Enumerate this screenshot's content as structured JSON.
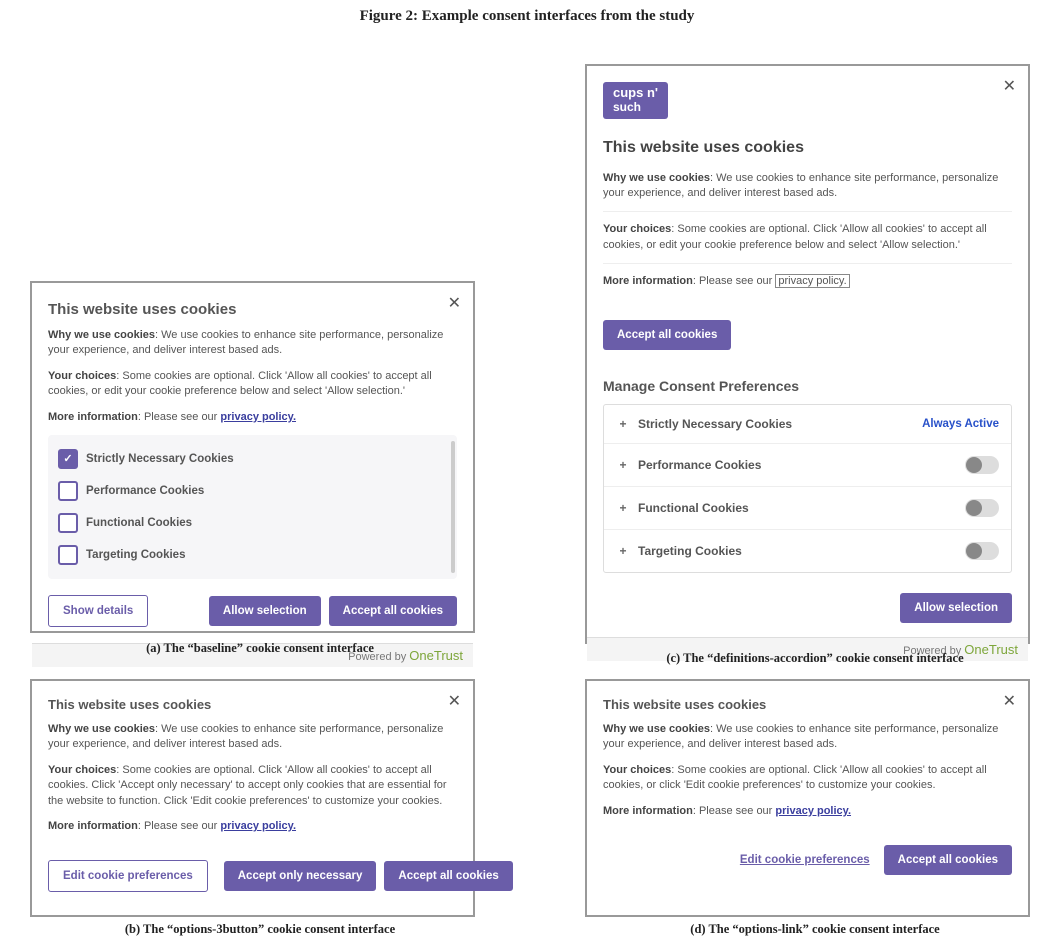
{
  "figure_title": "Figure 2: Example consent interfaces from the study",
  "captions": {
    "a": "(a) The “baseline” cookie consent interface",
    "b": "(b) The “options-3button” cookie consent interface",
    "c": "(c) The “definitions-accordion” cookie consent interface",
    "d": "(d) The “options-link” cookie consent interface"
  },
  "common": {
    "title": "This website uses cookies",
    "why_label": "Why we use cookies",
    "why_text": ": We use cookies to enhance site performance, personalize your experience, and deliver interest based ads.",
    "more_label": "More information",
    "more_text": ": Please see our  ",
    "privacy": "privacy policy.",
    "powered": "Powered by",
    "onetrust": "OneTrust",
    "close": "✕"
  },
  "panel_a": {
    "choices_label": "Your choices",
    "choices_text": ": Some cookies are optional. Click 'Allow all cookies' to accept all cookies, or edit your cookie preference below and select 'Allow selection.'",
    "cookies": [
      {
        "label": "Strictly Necessary Cookies",
        "checked": true
      },
      {
        "label": "Performance Cookies",
        "checked": false
      },
      {
        "label": "Functional Cookies",
        "checked": false
      },
      {
        "label": "Targeting Cookies",
        "checked": false
      }
    ],
    "show_details": "Show details",
    "allow_selection": "Allow selection",
    "accept_all": "Accept all cookies"
  },
  "panel_b": {
    "choices_label": "Your choices",
    "choices_text": ": Some cookies are optional. Click 'Allow all cookies' to accept all cookies. Click 'Accept only necessary' to accept only cookies that are essential for the website to function. Click 'Edit cookie preferences' to customize your cookies.",
    "edit_prefs": "Edit cookie preferences",
    "accept_necessary": "Accept only necessary",
    "accept_all": "Accept all cookies"
  },
  "panel_c": {
    "logo_l1": "cups n'",
    "logo_l2": "such",
    "choices_label": "Your choices",
    "choices_text": ": Some cookies are optional. Click 'Allow all cookies' to accept all cookies, or edit your cookie preference below and select 'Allow selection.'",
    "accept_all": "Accept all cookies",
    "manage_title": "Manage Consent Preferences",
    "always_active": "Always Active",
    "rows": [
      {
        "label": "Strictly Necessary Cookies",
        "always": true
      },
      {
        "label": "Performance Cookies",
        "always": false
      },
      {
        "label": "Functional Cookies",
        "always": false
      },
      {
        "label": "Targeting Cookies",
        "always": false
      }
    ],
    "allow_selection": "Allow selection"
  },
  "panel_d": {
    "choices_label": "Your choices",
    "choices_text": ": Some cookies are optional. Click 'Allow all cookies' to accept all cookies, or click 'Edit cookie preferences' to customize your cookies.",
    "edit_prefs": "Edit cookie preferences",
    "accept_all": "Accept all cookies"
  }
}
